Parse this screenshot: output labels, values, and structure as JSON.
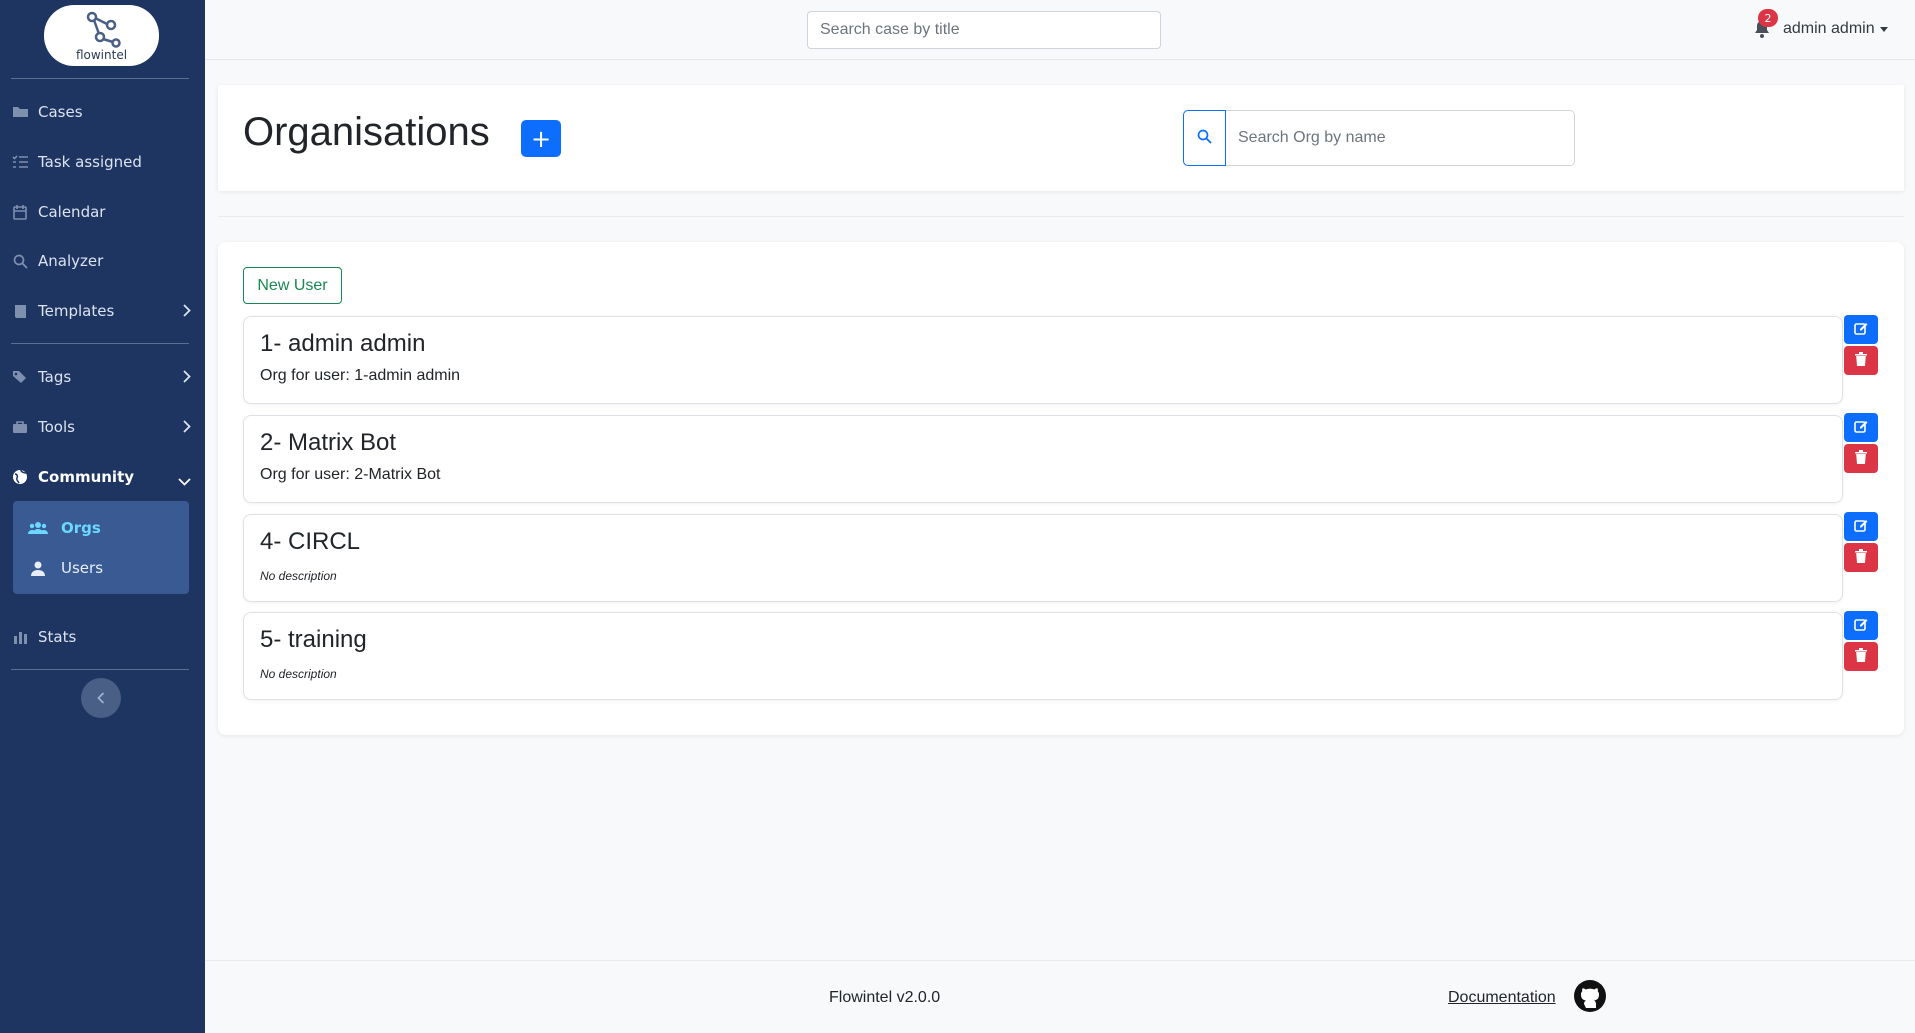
{
  "app": {
    "logo_text": "flowintel"
  },
  "sidebar": {
    "items": [
      {
        "label": "Cases",
        "icon": "folder-icon"
      },
      {
        "label": "Task assigned",
        "icon": "task-list-icon"
      },
      {
        "label": "Calendar",
        "icon": "calendar-icon"
      },
      {
        "label": "Analyzer",
        "icon": "search-icon"
      },
      {
        "label": "Templates",
        "icon": "book-icon"
      },
      {
        "label": "Tags",
        "icon": "tags-icon"
      },
      {
        "label": "Tools",
        "icon": "toolbox-icon"
      },
      {
        "label": "Community",
        "icon": "globe-icon"
      },
      {
        "label": "Stats",
        "icon": "bar-chart-icon"
      }
    ],
    "submenu": [
      {
        "label": "Orgs",
        "icon": "users-icon",
        "active": true
      },
      {
        "label": "Users",
        "icon": "user-icon",
        "active": false
      }
    ]
  },
  "topbar": {
    "search_placeholder": "Search case by title",
    "notification_count": "2",
    "user_name": "admin admin"
  },
  "header": {
    "title": "Organisations",
    "add_label": "+",
    "search_placeholder": "Search Org by name"
  },
  "main": {
    "new_user_label": "New User",
    "orgs": [
      {
        "name": "1- admin admin",
        "description": "Org for user: 1-admin admin",
        "has_description": true
      },
      {
        "name": "2- Matrix Bot",
        "description": "Org for user: 2-Matrix Bot",
        "has_description": true
      },
      {
        "name": "4- CIRCL",
        "description": "No description",
        "has_description": false
      },
      {
        "name": "5- training",
        "description": "No description",
        "has_description": false
      }
    ]
  },
  "footer": {
    "version": "Flowintel v2.0.0",
    "documentation": "Documentation"
  },
  "colors": {
    "sidebar_bg": "#1e3461",
    "primary": "#0d6efd",
    "danger": "#dc3545",
    "success": "#198754",
    "active_sub": "#6ad8ff"
  }
}
